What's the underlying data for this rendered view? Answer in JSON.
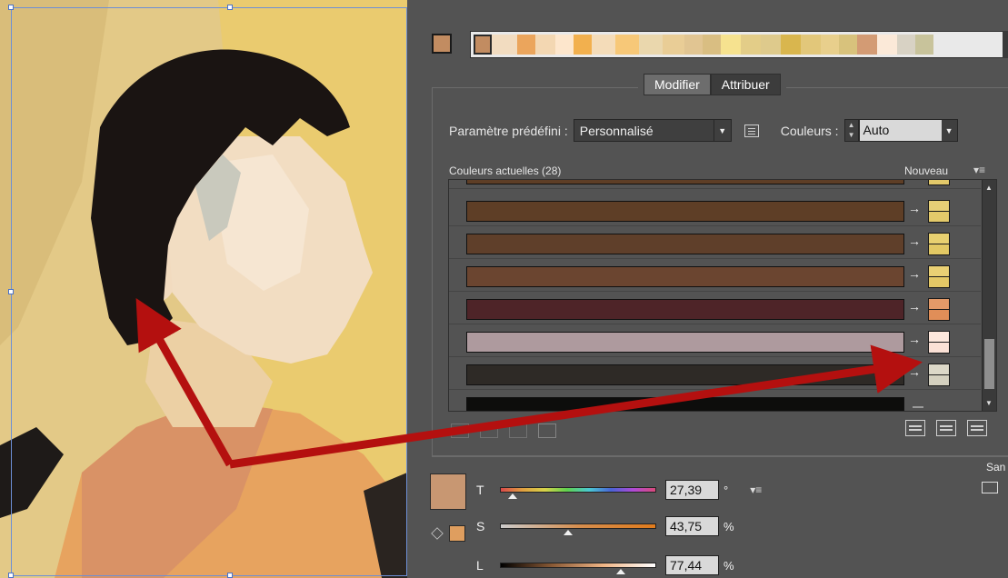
{
  "current_swatch_color": "#c28c61",
  "group_strip": {
    "first_color": "#c28c61",
    "cells": [
      "#f2dcc0",
      "#eba55c",
      "#f3d7b2",
      "#fde6cc",
      "#f2b04e",
      "#f4dcb9",
      "#f7c878",
      "#ead7ad",
      "#e9cd96",
      "#e1c592",
      "#d9be82",
      "#f6e28f",
      "#e3cd88",
      "#deca8c",
      "#d9b64e",
      "#e2c77a",
      "#e8cf8c",
      "#d8c27c",
      "#d39b74",
      "#fbe9d8",
      "#d8d2c4",
      "#c8c39b"
    ]
  },
  "tabs": {
    "modify": "Modifier",
    "assign": "Attribuer"
  },
  "preset": {
    "label": "Paramètre prédéfini :",
    "value": "Personnalisé",
    "colors_label": "Couleurs :",
    "colors_value": "Auto"
  },
  "list": {
    "current_label": "Couleurs actuelles (28)",
    "new_label": "Nouveau",
    "rows": [
      {
        "current": "#5e3e26",
        "new": [
          "#e6cf76",
          "#e3c96a"
        ]
      },
      {
        "current": "#5f3f2a",
        "new": [
          "#e8d070",
          "#e2c864"
        ]
      },
      {
        "current": "#6b4530",
        "new": [
          "#ead074",
          "#e4c866"
        ]
      },
      {
        "current": "#4e2428",
        "new": [
          "#e49a68",
          "#e08e58"
        ]
      },
      {
        "current": "#ae9a9e",
        "new": [
          "#fde7dc",
          "#fbe1d6"
        ]
      },
      {
        "current": "#2e2a26",
        "new": [
          "#dcd8c8",
          "#d4d0bf"
        ]
      },
      {
        "current": "#0d0d0c",
        "new": null
      }
    ]
  },
  "sliders": {
    "h": {
      "label": "T",
      "value": "27,39",
      "unit": "°",
      "pos": 0.076
    },
    "s": {
      "label": "S",
      "value": "43,75",
      "unit": "%",
      "pos": 0.4375
    },
    "l": {
      "label": "L",
      "value": "77,44",
      "unit": "%",
      "pos": 0.7744
    }
  },
  "side_label": "San",
  "selected_color": "#c89772",
  "fill_swatch_color": "#df9e5f"
}
